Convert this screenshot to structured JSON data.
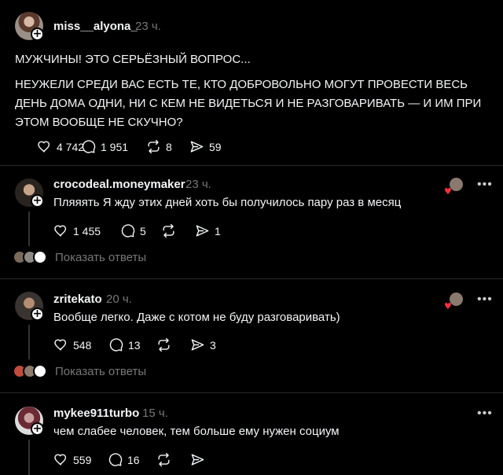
{
  "post": {
    "username": "miss__alyona_",
    "time": "23 ч.",
    "title": "МУЖЧИНЫ! ЭТО СЕРЬЁЗНЫЙ ВОПРОС...",
    "body": "НЕУЖЕЛИ СРЕДИ ВАС ЕСТЬ ТЕ, КТО ДОБРОВОЛЬНО МОГУТ ПРОВЕСТИ ВЕСЬ ДЕНЬ ДОМА ОДНИ, НИ С КЕМ НЕ ВИДЕТЬСЯ И НЕ РАЗГОВАРИВАТЬ — И ИМ ПРИ ЭТОМ ВООБЩЕ НЕ СКУЧНО?",
    "likes": "4 742",
    "replies": "1 951",
    "reposts": "8",
    "shares": "59"
  },
  "comments": [
    {
      "username": "crocodeal.moneymaker",
      "time": "23 ч.",
      "text": "Пляяять Я жду этих дней хоть бы получилось пару раз в месяц",
      "likes": "1 455",
      "replies": "5",
      "reposts": "",
      "shares": "1",
      "show_replies": "Показать ответы"
    },
    {
      "username": "zritekato",
      "time": "20 ч.",
      "text": "Вообще легко. Даже с котом не буду разговаривать)",
      "likes": "548",
      "replies": "13",
      "reposts": "",
      "shares": "3",
      "show_replies": "Показать ответы"
    },
    {
      "username": "mykee911turbo",
      "time": "15 ч.",
      "text": "чем слабее человек, тем больше ему нужен социум",
      "likes": "559",
      "replies": "16",
      "reposts": "",
      "shares": ""
    }
  ],
  "icons": {
    "like": "heart-icon",
    "reply": "comment-icon",
    "repost": "repost-icon",
    "share": "send-icon",
    "more": "more-icon",
    "follow": "plus-icon"
  },
  "colors": {
    "background": "#000000",
    "text": "#f3f5f7",
    "muted": "#777777",
    "liked": "#ff3040"
  }
}
